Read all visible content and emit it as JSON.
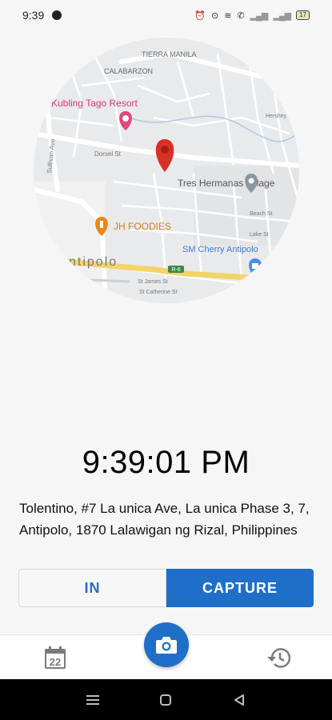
{
  "status_bar": {
    "time": "9:39",
    "battery": "17"
  },
  "map": {
    "labels": {
      "tierra_manila": "TIERRA MANILA",
      "calabarzon": "CALABARZON",
      "resort": "Kubling Tago Resort",
      "tres_hermanas": "Tres Hermanas Village",
      "jh_foodies": "JH FOODIES",
      "sm_cherry": "SM Cherry Antipolo",
      "antipolo": "ntipolo",
      "route": "R-6",
      "st_james": "St James St",
      "st_catherine": "St Catherine St",
      "sullivan": "Sullivan Ave",
      "dorsel": "Dorsel St",
      "hershey": "Hershey St",
      "beach": "Beach St",
      "lake": "Lake St"
    }
  },
  "clock": {
    "time": "9:39:01 PM"
  },
  "address": "Tolentino, #7 La unica Ave, La unica Phase 3, 7, Antipolo, 1870 Lalawigan ng Rizal, Philippines",
  "actions": {
    "in_label": "IN",
    "capture_label": "CAPTURE"
  },
  "bottom_nav": {
    "calendar_day": "22"
  },
  "colors": {
    "accent": "#1f6fc9",
    "pin": "#d93025",
    "resort_pink": "#e5457b",
    "food_orange": "#e8891d",
    "shop_blue": "#4a8fe7"
  }
}
